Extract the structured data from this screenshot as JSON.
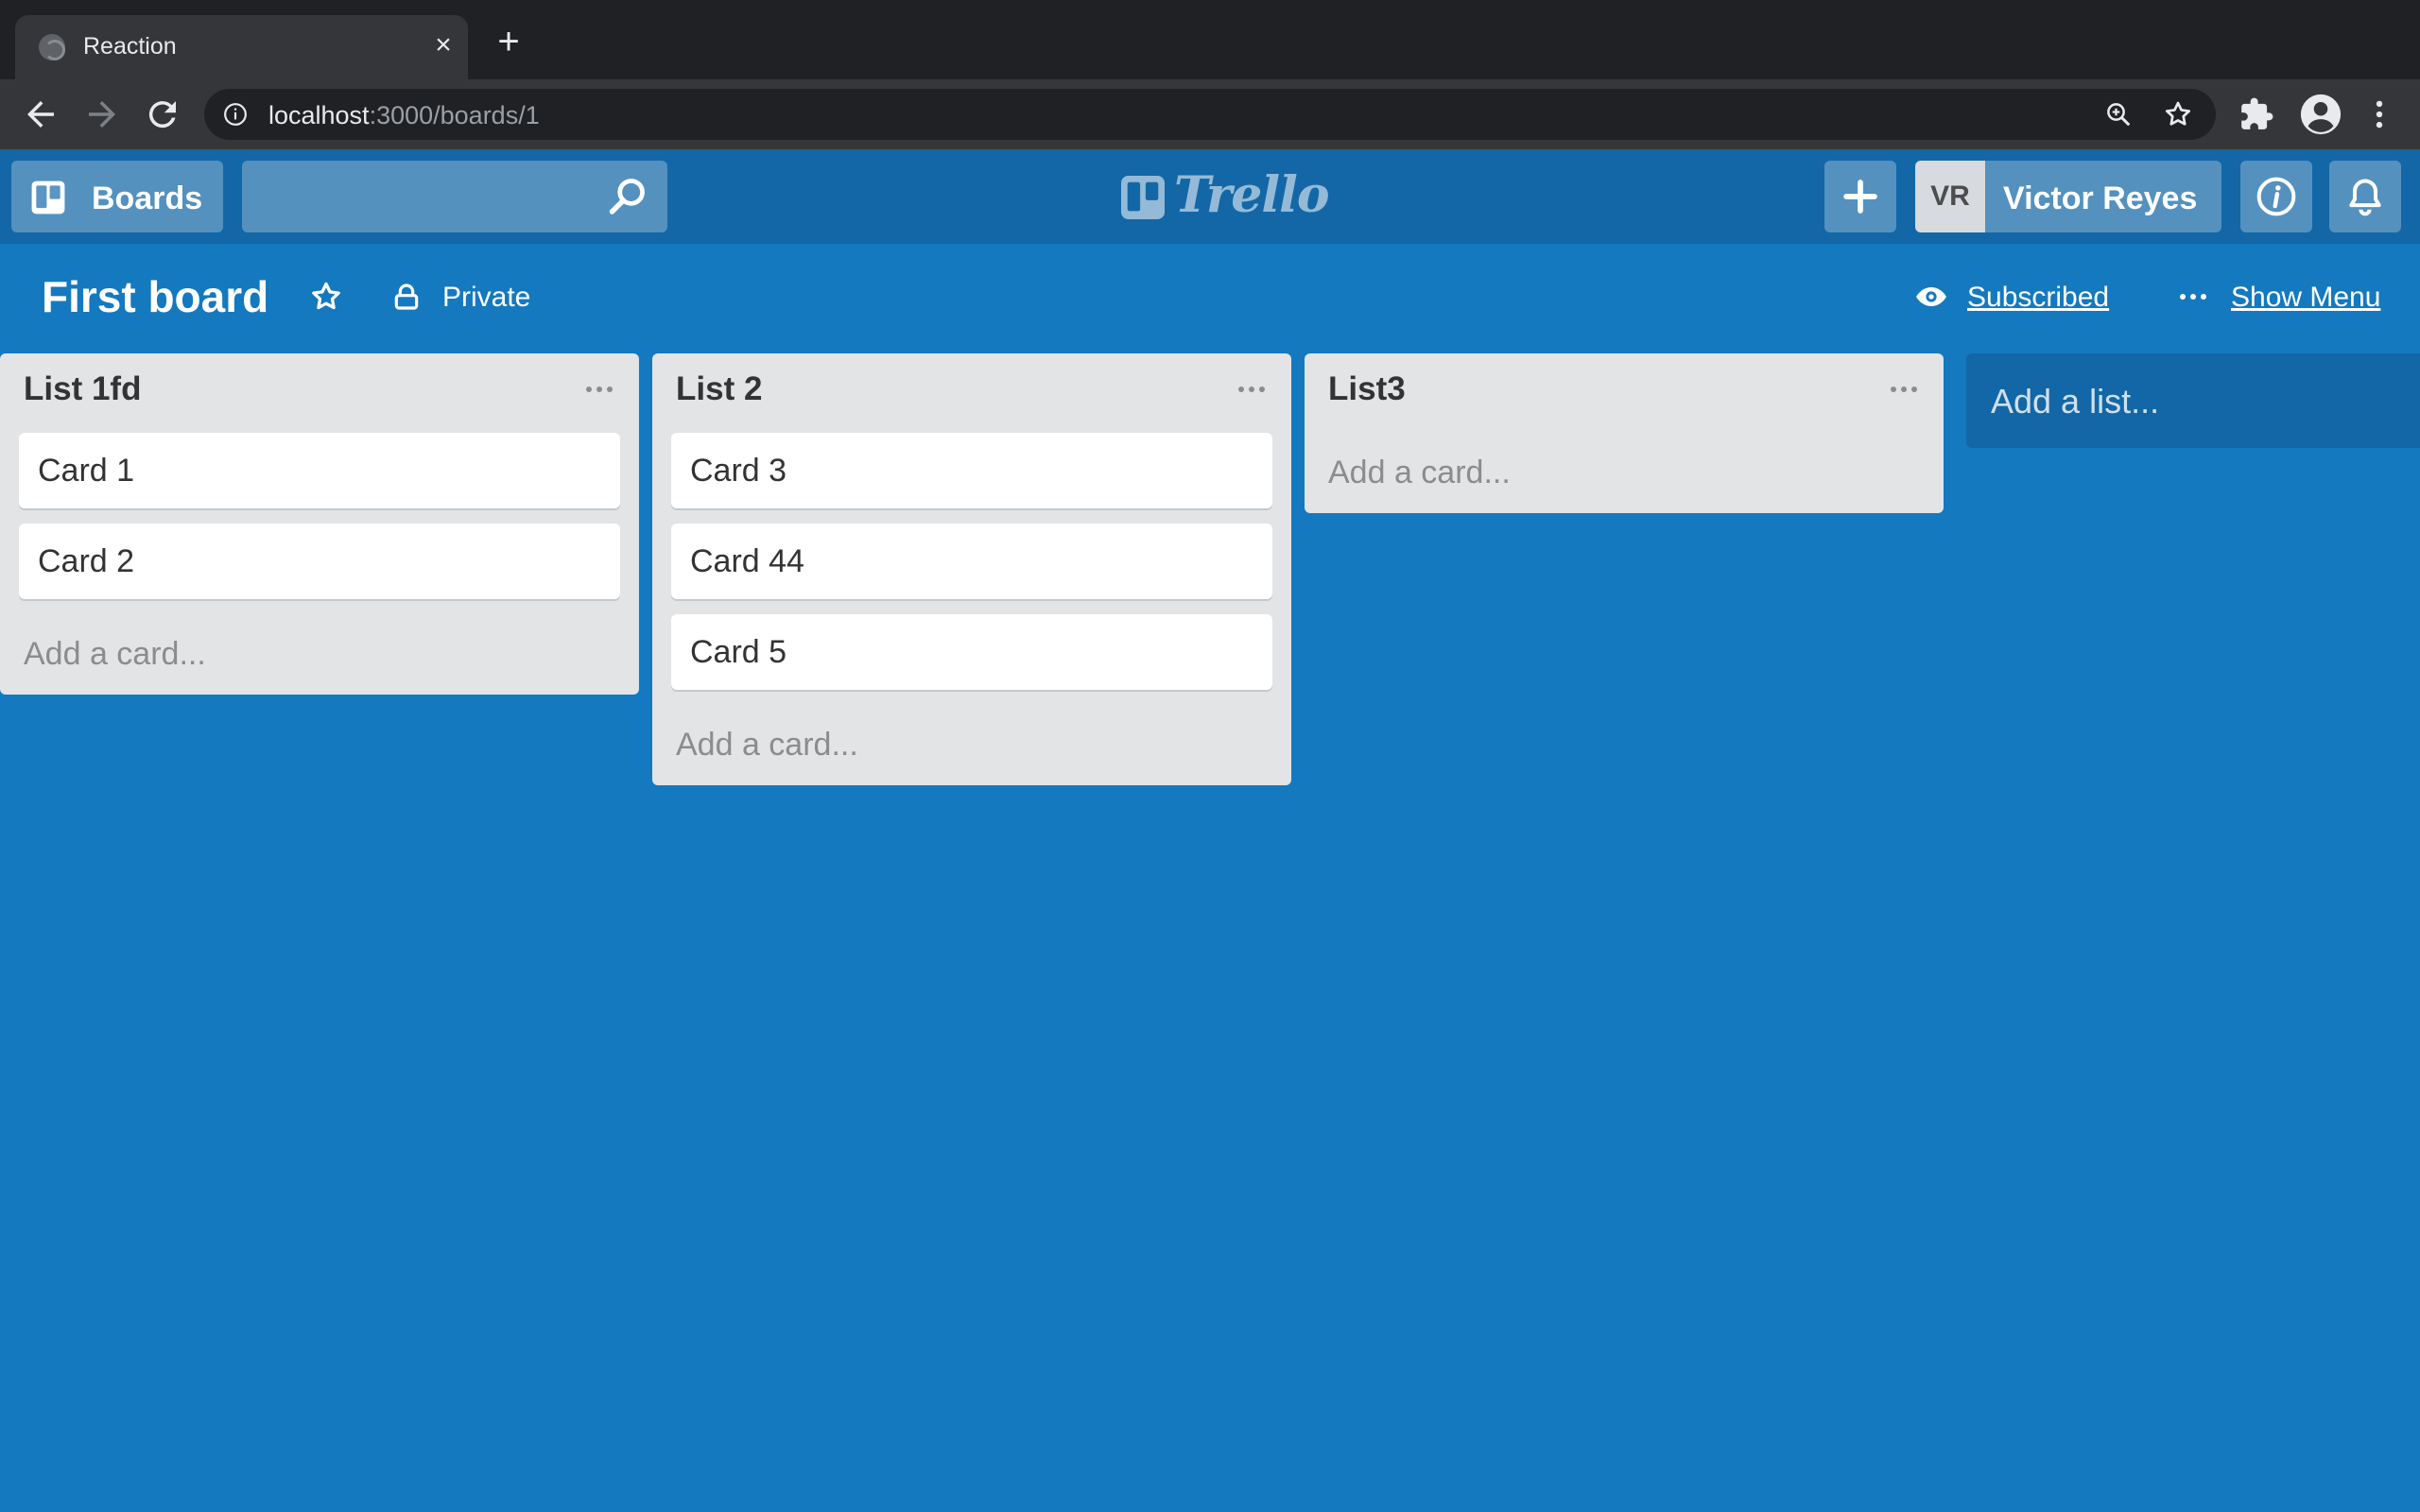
{
  "browser": {
    "tab_title": "Reaction",
    "url_host": "localhost",
    "url_path": ":3000/boards/1"
  },
  "header": {
    "boards_label": "Boards",
    "search_placeholder": "",
    "logo_text": "Trello",
    "user_initials": "VR",
    "user_name": "Victor Reyes"
  },
  "board": {
    "title": "First board",
    "visibility": "Private",
    "subscribed_label": "Subscribed",
    "show_menu_label": "Show Menu"
  },
  "lists": [
    {
      "title": "List 1fd",
      "cards": [
        "Card 1",
        "Card 2"
      ],
      "add_card_label": "Add a card..."
    },
    {
      "title": "List 2",
      "cards": [
        "Card 3",
        "Card 44",
        "Card 5"
      ],
      "add_card_label": "Add a card..."
    },
    {
      "title": "List3",
      "cards": [],
      "add_card_label": "Add a card..."
    }
  ],
  "add_list_label": "Add a list...",
  "colors": {
    "board_background": "#1479bf",
    "header_background": "#1367a6",
    "list_background": "#e2e4e6"
  }
}
